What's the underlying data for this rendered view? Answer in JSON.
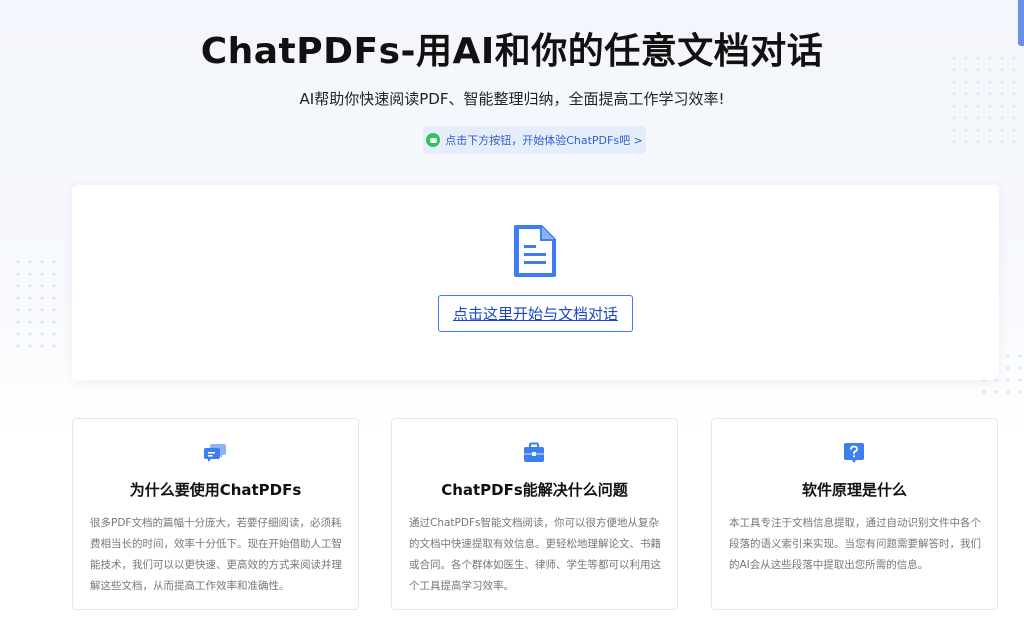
{
  "header": {
    "title": "ChatPDFs-用AI和你的任意文档对话",
    "subtitle": "AI帮助你快速阅读PDF、智能整理归纳，全面提高工作学习效率!",
    "tip": "点击下方按钮，开始体验ChatPDFs吧 >"
  },
  "upload": {
    "icon": "document-icon",
    "button_label": "点击这里开始与文档对话"
  },
  "features": [
    {
      "icon": "chat-bubbles-icon",
      "title": "为什么要使用ChatPDFs",
      "text": "很多PDF文档的篇幅十分庞大，若要仔细阅读，必须耗费相当长的时间，效率十分低下。现在开始借助人工智能技术，我们可以以更快速、更高效的方式来阅读并理解这些文档，从而提高工作效率和准确性。"
    },
    {
      "icon": "briefcase-icon",
      "title": "ChatPDFs能解决什么问题",
      "text": "通过ChatPDFs智能文档阅读，你可以很方便地从复杂的文档中快速提取有效信息。更轻松地理解论文、书籍或合同。各个群体如医生、律师、学生等都可以利用这个工具提高学习效率。"
    },
    {
      "icon": "question-icon",
      "title": "软件原理是什么",
      "text": "本工具专注于文档信息提取，通过自动识别文件中各个段落的语义索引来实现。当您有问题需要解答时，我们的AI会从这些段落中提取出您所需的信息。"
    }
  ],
  "colors": {
    "accent": "#3f7bf0",
    "link": "#1a46c8",
    "tip_bg": "#e5edfb",
    "icon_blue": "#3d7ef0"
  }
}
